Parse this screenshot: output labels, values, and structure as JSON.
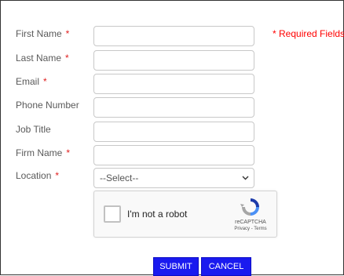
{
  "form": {
    "fields": [
      {
        "label": "First Name",
        "required_mark": "*"
      },
      {
        "label": "Last Name",
        "required_mark": "*"
      },
      {
        "label": "Email",
        "required_mark": "*"
      },
      {
        "label": "Phone Number",
        "required_mark": ""
      },
      {
        "label": "Job Title",
        "required_mark": ""
      },
      {
        "label": "Firm Name",
        "required_mark": "*"
      }
    ],
    "location": {
      "label": "Location",
      "required_mark": "*",
      "selected": "--Select--"
    },
    "required_note": "* Required Fields"
  },
  "captcha": {
    "label": "I'm not a robot",
    "brand": "reCAPTCHA",
    "privacy": "Privacy",
    "terms": "Terms",
    "icon": "recaptcha-logo"
  },
  "buttons": {
    "submit": "SUBMIT",
    "cancel": "CANCEL"
  },
  "colors": {
    "required": "#ff0000",
    "button": "#1a1aef",
    "border": "#c8c8c8"
  }
}
